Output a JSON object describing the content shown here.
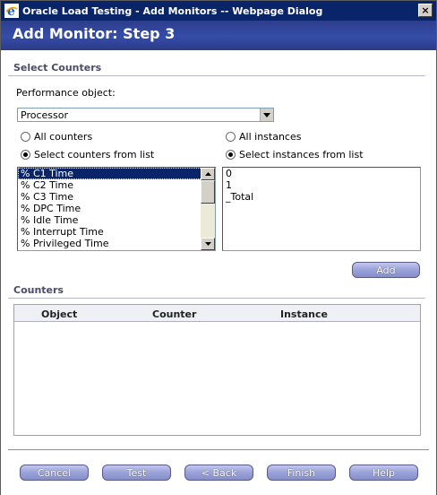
{
  "window": {
    "title": "Oracle Load Testing - Add Monitors -- Webpage Dialog",
    "close_label": "×"
  },
  "header": {
    "page_title": "Add Monitor: Step 3"
  },
  "select_counters": {
    "section_title": "Select Counters",
    "performance_object_label": "Performance object:",
    "performance_object_value": "Processor",
    "counters_radio": {
      "all_label": "All counters",
      "list_label": "Select counters from list",
      "selected": "list"
    },
    "instances_radio": {
      "all_label": "All instances",
      "list_label": "Select instances from list",
      "selected": "list"
    },
    "counters": [
      "% C1 Time",
      "% C2 Time",
      "% C3 Time",
      "% DPC Time",
      "% Idle Time",
      "% Interrupt Time",
      "% Privileged Time"
    ],
    "selected_counter": "% C1 Time",
    "instances": [
      "0",
      "1",
      "_Total"
    ],
    "add_label": "Add"
  },
  "counters_table": {
    "section_title": "Counters",
    "columns": [
      "Object",
      "Counter",
      "Instance"
    ],
    "rows": []
  },
  "footer": {
    "cancel_label": "Cancel",
    "test_label": "Test",
    "back_label": "< Back",
    "finish_label": "Finish",
    "help_label": "Help"
  },
  "colors": {
    "title_bar": "#0a246a",
    "header_band": "#354da8",
    "button": "#9aa2d8",
    "selection": "#0a246a"
  }
}
